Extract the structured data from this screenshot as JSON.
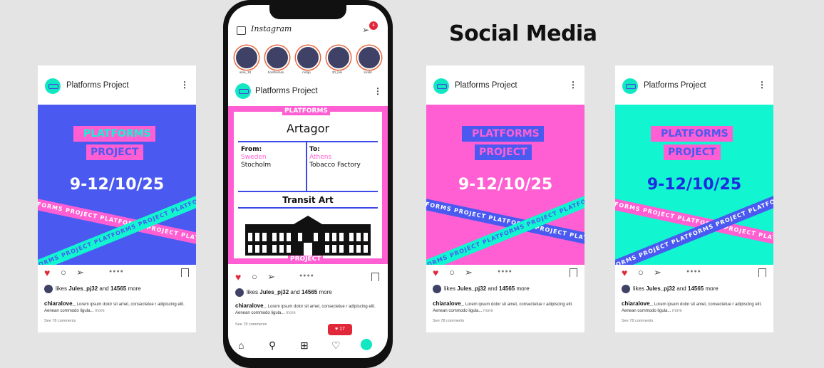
{
  "heading": "Social Media",
  "account_name": "Platforms Project",
  "kebab": "⋮",
  "art": {
    "bracket_top": "PLATFORMS",
    "bracket_bottom": "PROJECT",
    "date": "9-12/10/25",
    "band_text": "PLATFORMS PROJECT PLATFORMS PROJECT PLATFORMS"
  },
  "engagement": {
    "likes_prefix": "likes",
    "liked_by": "Jules_pj32",
    "likes_middle": "and",
    "likes_count": "14565",
    "likes_suffix": "more",
    "caption_user": "chiaralove_",
    "caption_text": "Lorem ipsum dolor sit amet, consectetue r adipiscing elit. Aenean commodo ligula...",
    "caption_more": "more",
    "comments": "See 78 comments"
  },
  "posts": [
    {
      "bg": "#4a5af0",
      "date_color": "#ffffff"
    },
    {
      "bg": "#ff5fd2",
      "date_color": "#ffffff"
    },
    {
      "bg": "#11f5d0",
      "date_color": "#1e2be0"
    }
  ],
  "phone": {
    "app_name": "Instagram",
    "dm_badge": "4",
    "stories": [
      "ame_18",
      "bonthomas",
      "nickjp",
      "30_luis",
      "lorald"
    ],
    "poster": {
      "top_tag": "PLATFORMS",
      "bottom_tag": "PROJECT",
      "title": "Artagor",
      "from_label": "From:",
      "from_country": "Sweden",
      "from_city": "Stocholm",
      "to_label": "To:",
      "to_city": "Athens",
      "to_venue": "Tobacco Factory",
      "subtitle": "Transit Art"
    },
    "notification": "♥ 17"
  },
  "icons": [
    "heart-icon",
    "comment-icon",
    "send-icon",
    "bookmark-icon",
    "home-icon",
    "search-icon",
    "add-icon",
    "activity-icon",
    "camera-icon",
    "direct-message-icon"
  ]
}
